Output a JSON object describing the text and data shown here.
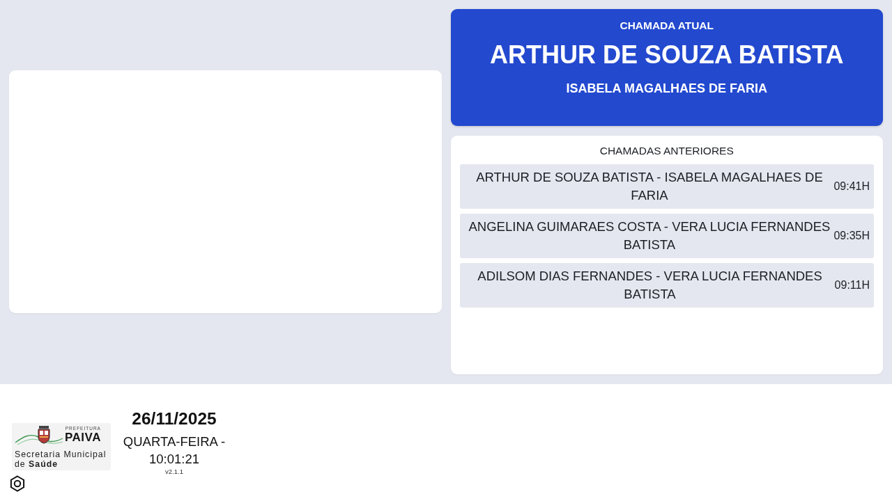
{
  "current_call": {
    "heading": "CHAMADA ATUAL",
    "patient": "ARTHUR DE SOUZA BATISTA",
    "professional": "ISABELA MAGALHAES DE FARIA"
  },
  "previous_calls": {
    "heading": "CHAMADAS ANTERIORES",
    "items": [
      {
        "names": "ARTHUR DE SOUZA BATISTA - ISABELA MAGALHAES DE FARIA",
        "time": "09:41H"
      },
      {
        "names": "ANGELINA GUIMARAES COSTA - VERA LUCIA FERNANDES BATISTA",
        "time": "09:35H"
      },
      {
        "names": "ADILSOM DIAS FERNANDES - VERA LUCIA FERNANDES BATISTA",
        "time": "09:11H"
      }
    ]
  },
  "footer": {
    "logo": {
      "prefix": "PREFEITURA",
      "name": "PAIVA",
      "department": "Secretaria Municipal de **Saúde**"
    },
    "date": "26/11/2025",
    "weekday_time": "QUARTA-FEIRA - 10:01:21",
    "version": "v2.1.1"
  }
}
